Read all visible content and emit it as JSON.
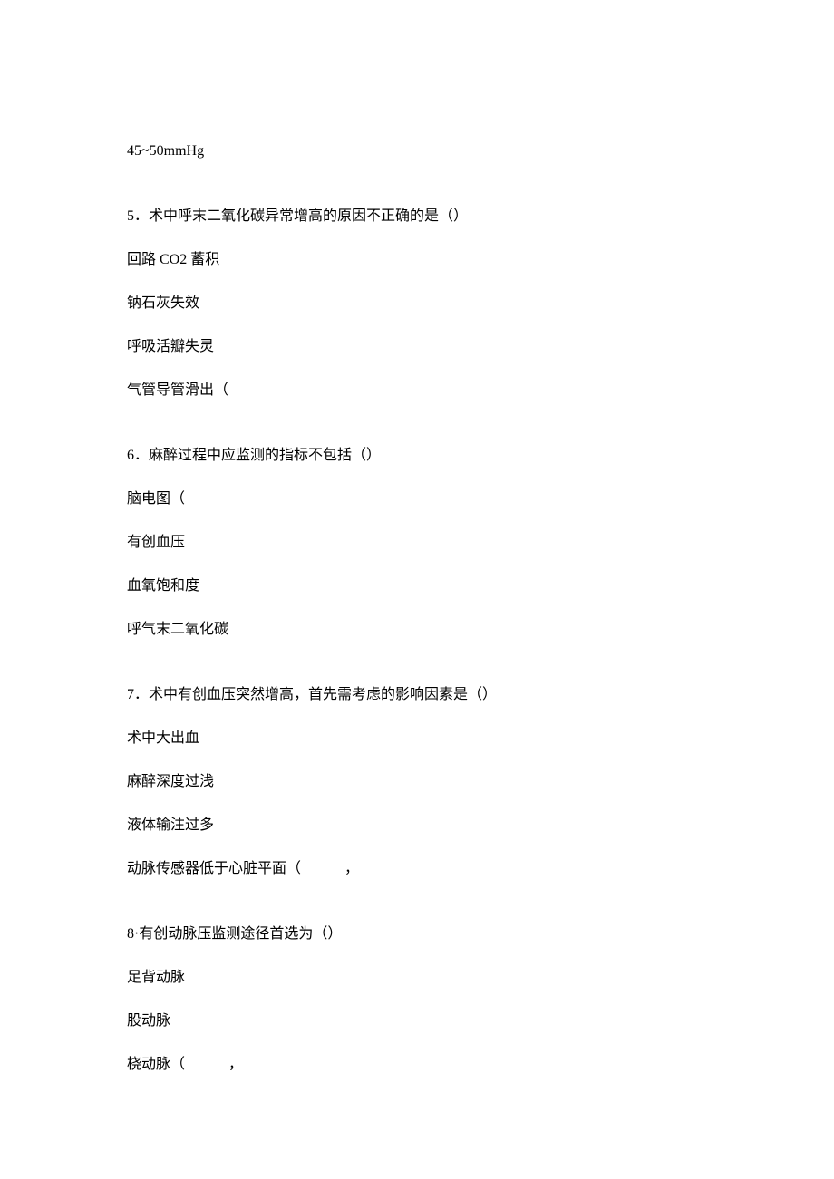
{
  "top_line": "45~50mmHg",
  "questions": [
    {
      "num": "5",
      "stem": "．术中呼末二氧化碳异常增高的原因不正确的是（）",
      "opts": [
        "回路 CO2 蓄积",
        "钠石灰失效",
        "呼吸活瓣失灵",
        "气管导管滑出（"
      ]
    },
    {
      "num": "6",
      "stem": "．麻醉过程中应监测的指标不包括（）",
      "opts": [
        "脑电图（",
        "有创血压",
        "血氧饱和度",
        "呼气末二氧化碳"
      ]
    },
    {
      "num": "7",
      "stem": "．术中有创血压突然增高，首先需考虑的影响因素是（）",
      "opts": [
        "术中大出血",
        "麻醉深度过浅",
        "液体输注过多",
        "动脉传感器低于心脏平面（　　　，"
      ]
    },
    {
      "num": "8",
      "stem": "·有创动脉压监测途径首选为（）",
      "opts": [
        "足背动脉",
        "股动脉",
        "桡动脉（　　　，"
      ],
      "stem_inline": true
    }
  ]
}
